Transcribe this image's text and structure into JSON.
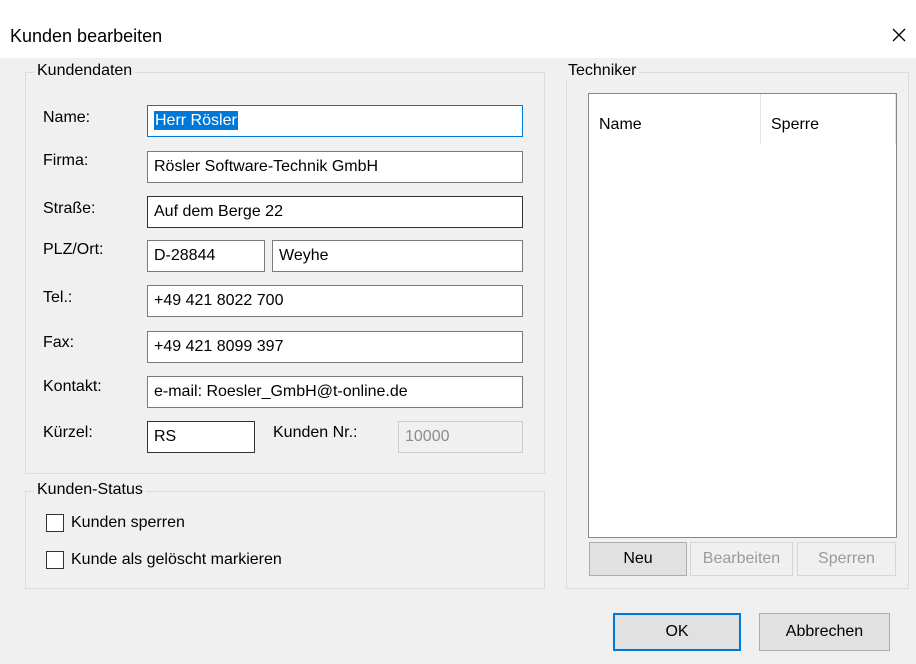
{
  "window": {
    "title": "Kunden bearbeiten",
    "close_icon": "close-icon"
  },
  "kundendaten": {
    "title": "Kundendaten",
    "name_label": "Name:",
    "name_value": "Herr Rösler",
    "firma_label": "Firma:",
    "firma_value": "Rösler Software-Technik GmbH",
    "strasse_label": "Straße:",
    "strasse_value": "Auf dem Berge 22",
    "plzort_label": "PLZ/Ort:",
    "plz_value": "D-28844",
    "ort_value": "Weyhe",
    "tel_label": "Tel.:",
    "tel_value": "+49 421 8022 700",
    "fax_label": "Fax:",
    "fax_value": "+49 421 8099 397",
    "kontakt_label": "Kontakt:",
    "kontakt_value": "e-mail: Roesler_GmbH@t-online.de",
    "kuerzel_label": "Kürzel:",
    "kuerzel_value": "RS",
    "kundennr_label": "Kunden Nr.:",
    "kundennr_value": "10000"
  },
  "status": {
    "title": "Kunden-Status",
    "sperren_label": "Kunden sperren",
    "sperren_checked": false,
    "geloescht_label": "Kunde als gelöscht markieren",
    "geloescht_checked": false
  },
  "techniker": {
    "title": "Techniker",
    "columns": [
      "Name",
      "Sperre"
    ],
    "rows": [],
    "neu_label": "Neu",
    "bearbeiten_label": "Bearbeiten",
    "sperren_label": "Sperren"
  },
  "footer": {
    "ok_label": "OK",
    "abbrechen_label": "Abbrechen"
  },
  "colors": {
    "accent": "#0078d7",
    "dialog_bg": "#f0f0f0"
  }
}
